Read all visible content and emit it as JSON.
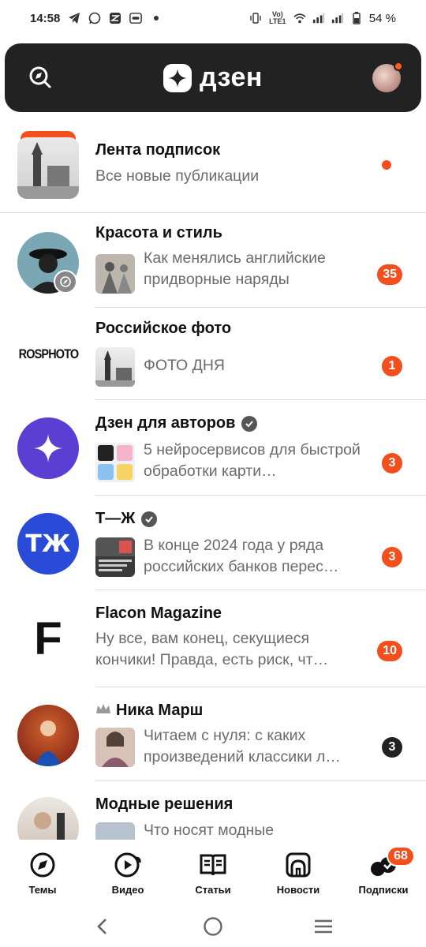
{
  "status_bar": {
    "time": "14:58",
    "network": "Vo) LTE1",
    "battery": "54 %"
  },
  "header": {
    "logo_text": "дзен"
  },
  "feed": [
    {
      "title": "Лента подписок",
      "snippet": "Все новые публикации",
      "badge": ""
    },
    {
      "title": "Красота и стиль",
      "snippet": "Как менялись английские придворные наряды",
      "badge": "35"
    },
    {
      "title": "Российское  фото",
      "snippet": "ФОТО ДНЯ",
      "badge": "1",
      "avatar_text": "ROSPHOTO"
    },
    {
      "title": "Дзен для авторов",
      "snippet": "5 нейросервисов для быстрой обработки карти…",
      "badge": "3"
    },
    {
      "title": "Т—Ж",
      "snippet": "В конце 2024 года у ряда российских банков перес…",
      "badge": "3"
    },
    {
      "title": "Flacon Magazine",
      "snippet": "Ну все, вам конец, секущиеся кончики! Правда, есть риск, чт…",
      "badge": "10",
      "avatar_text": "F"
    },
    {
      "title": "Ника Марш",
      "snippet": "Читаем с нуля: с каких произведений классики л…",
      "badge": "3"
    },
    {
      "title": "Модные решения",
      "snippet": "Что носят модные",
      "badge": ""
    }
  ],
  "bottom_nav": {
    "items": [
      {
        "label": "Темы",
        "icon": "compass-icon"
      },
      {
        "label": "Видео",
        "icon": "video-icon"
      },
      {
        "label": "Статьи",
        "icon": "articles-icon"
      },
      {
        "label": "Новости",
        "icon": "news-icon"
      },
      {
        "label": "Подписки",
        "icon": "subscriptions-icon",
        "badge": "68"
      }
    ]
  },
  "colors": {
    "accent": "#f24e1e",
    "header_bg": "#222222"
  }
}
